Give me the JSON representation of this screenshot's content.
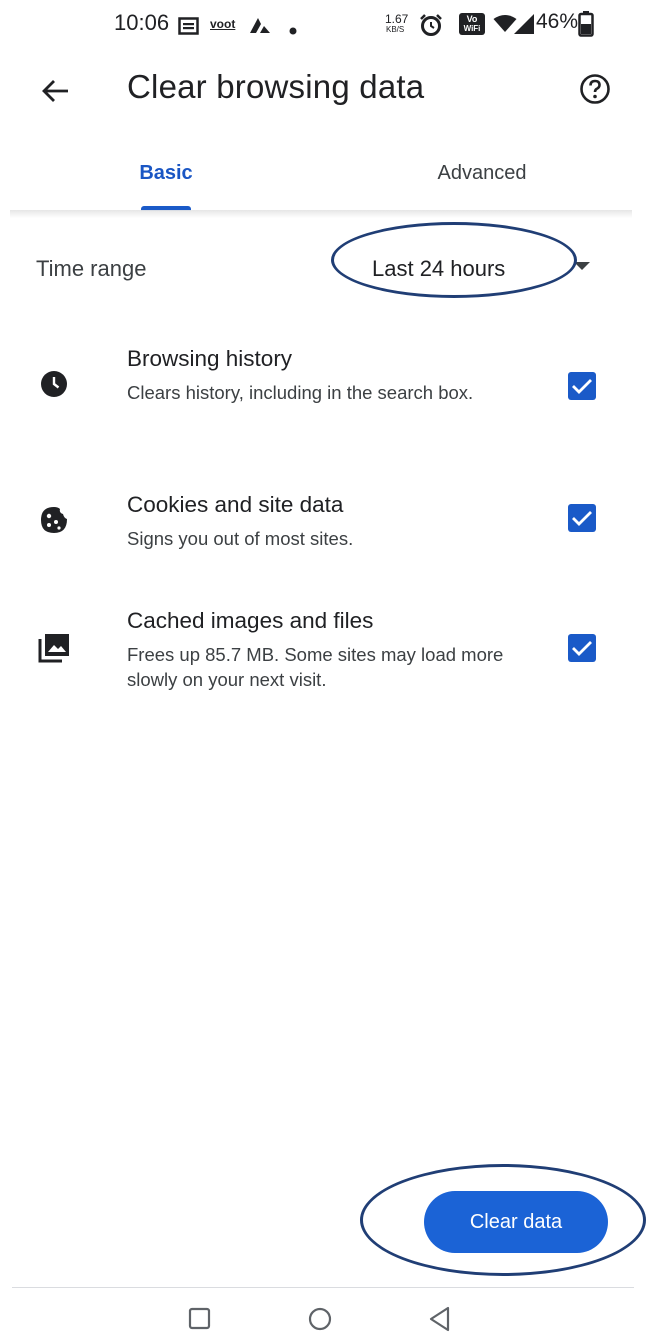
{
  "status_bar": {
    "time": "10:06",
    "speed_value": "1.67",
    "speed_unit": "KB/S",
    "volte_line1": "Vo",
    "volte_line2": "WiFi",
    "battery_percent": "46%",
    "icons": [
      "news-icon",
      "voot-icon",
      "app-icon",
      "dot-icon",
      "alarm-icon",
      "wifi-calling-icon",
      "wifi-icon",
      "signal-icon",
      "battery-icon"
    ],
    "voot_label": "voot"
  },
  "app_bar": {
    "title": "Clear browsing data",
    "back_icon": "arrow-back-icon",
    "help_icon": "help-circle-icon"
  },
  "tabs": [
    {
      "label": "Basic",
      "selected": true
    },
    {
      "label": "Advanced",
      "selected": false
    }
  ],
  "time_range": {
    "label": "Time range",
    "value": "Last 24 hours"
  },
  "items": [
    {
      "icon": "clock-icon",
      "title": "Browsing history",
      "description": "Clears history, including in the search box.",
      "checked": true
    },
    {
      "icon": "cookie-icon",
      "title": "Cookies and site data",
      "description": "Signs you out of most sites.",
      "checked": true
    },
    {
      "icon": "image-collection-icon",
      "title": "Cached images and files",
      "description": "Frees up 85.7 MB. Some sites may load more slowly on your next visit.",
      "checked": true
    }
  ],
  "clear_button": {
    "label": "Clear data"
  },
  "colors": {
    "accent": "#1a5ac8",
    "button": "#1b63d6",
    "annotation": "#203e75"
  },
  "nav_bar": {
    "icons": [
      "recents-square-icon",
      "home-circle-icon",
      "back-triangle-icon"
    ]
  }
}
